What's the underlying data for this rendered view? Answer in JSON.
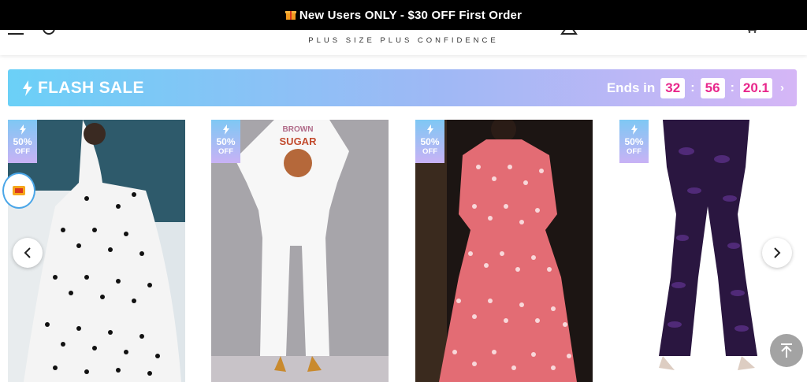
{
  "promo": {
    "text": "New Users ONLY - $30 OFF First Order",
    "icon": "gift-icon"
  },
  "header": {
    "tagline": "PLUS SIZE PLUS CONFIDENCE"
  },
  "flash_sale": {
    "title": "FLASH SALE",
    "ends_label": "Ends in",
    "hours": "32",
    "minutes": "56",
    "seconds": "20.1",
    "accent_color": "#e8288c"
  },
  "products": [
    {
      "badge_pct": "50%",
      "badge_off": "OFF",
      "name_hint": "white polka dot tiered maxi dress"
    },
    {
      "badge_pct": "50%",
      "badge_off": "OFF",
      "name_hint": "white graphic tee and pants set"
    },
    {
      "badge_pct": "50%",
      "badge_off": "OFF",
      "name_hint": "pink polka dot sheer maxi dress"
    },
    {
      "badge_pct": "50%",
      "badge_off": "OFF",
      "name_hint": "purple sequin stacked pants"
    }
  ],
  "icons": {
    "menu": "menu-icon",
    "search": "search-icon",
    "user": "user-icon",
    "wishlist": "heart-icon",
    "cart": "cart-icon",
    "prev": "chevron-left-icon",
    "next": "chevron-right-icon",
    "back_to_top": "arrow-up-icon",
    "coupon": "coupon-icon"
  }
}
